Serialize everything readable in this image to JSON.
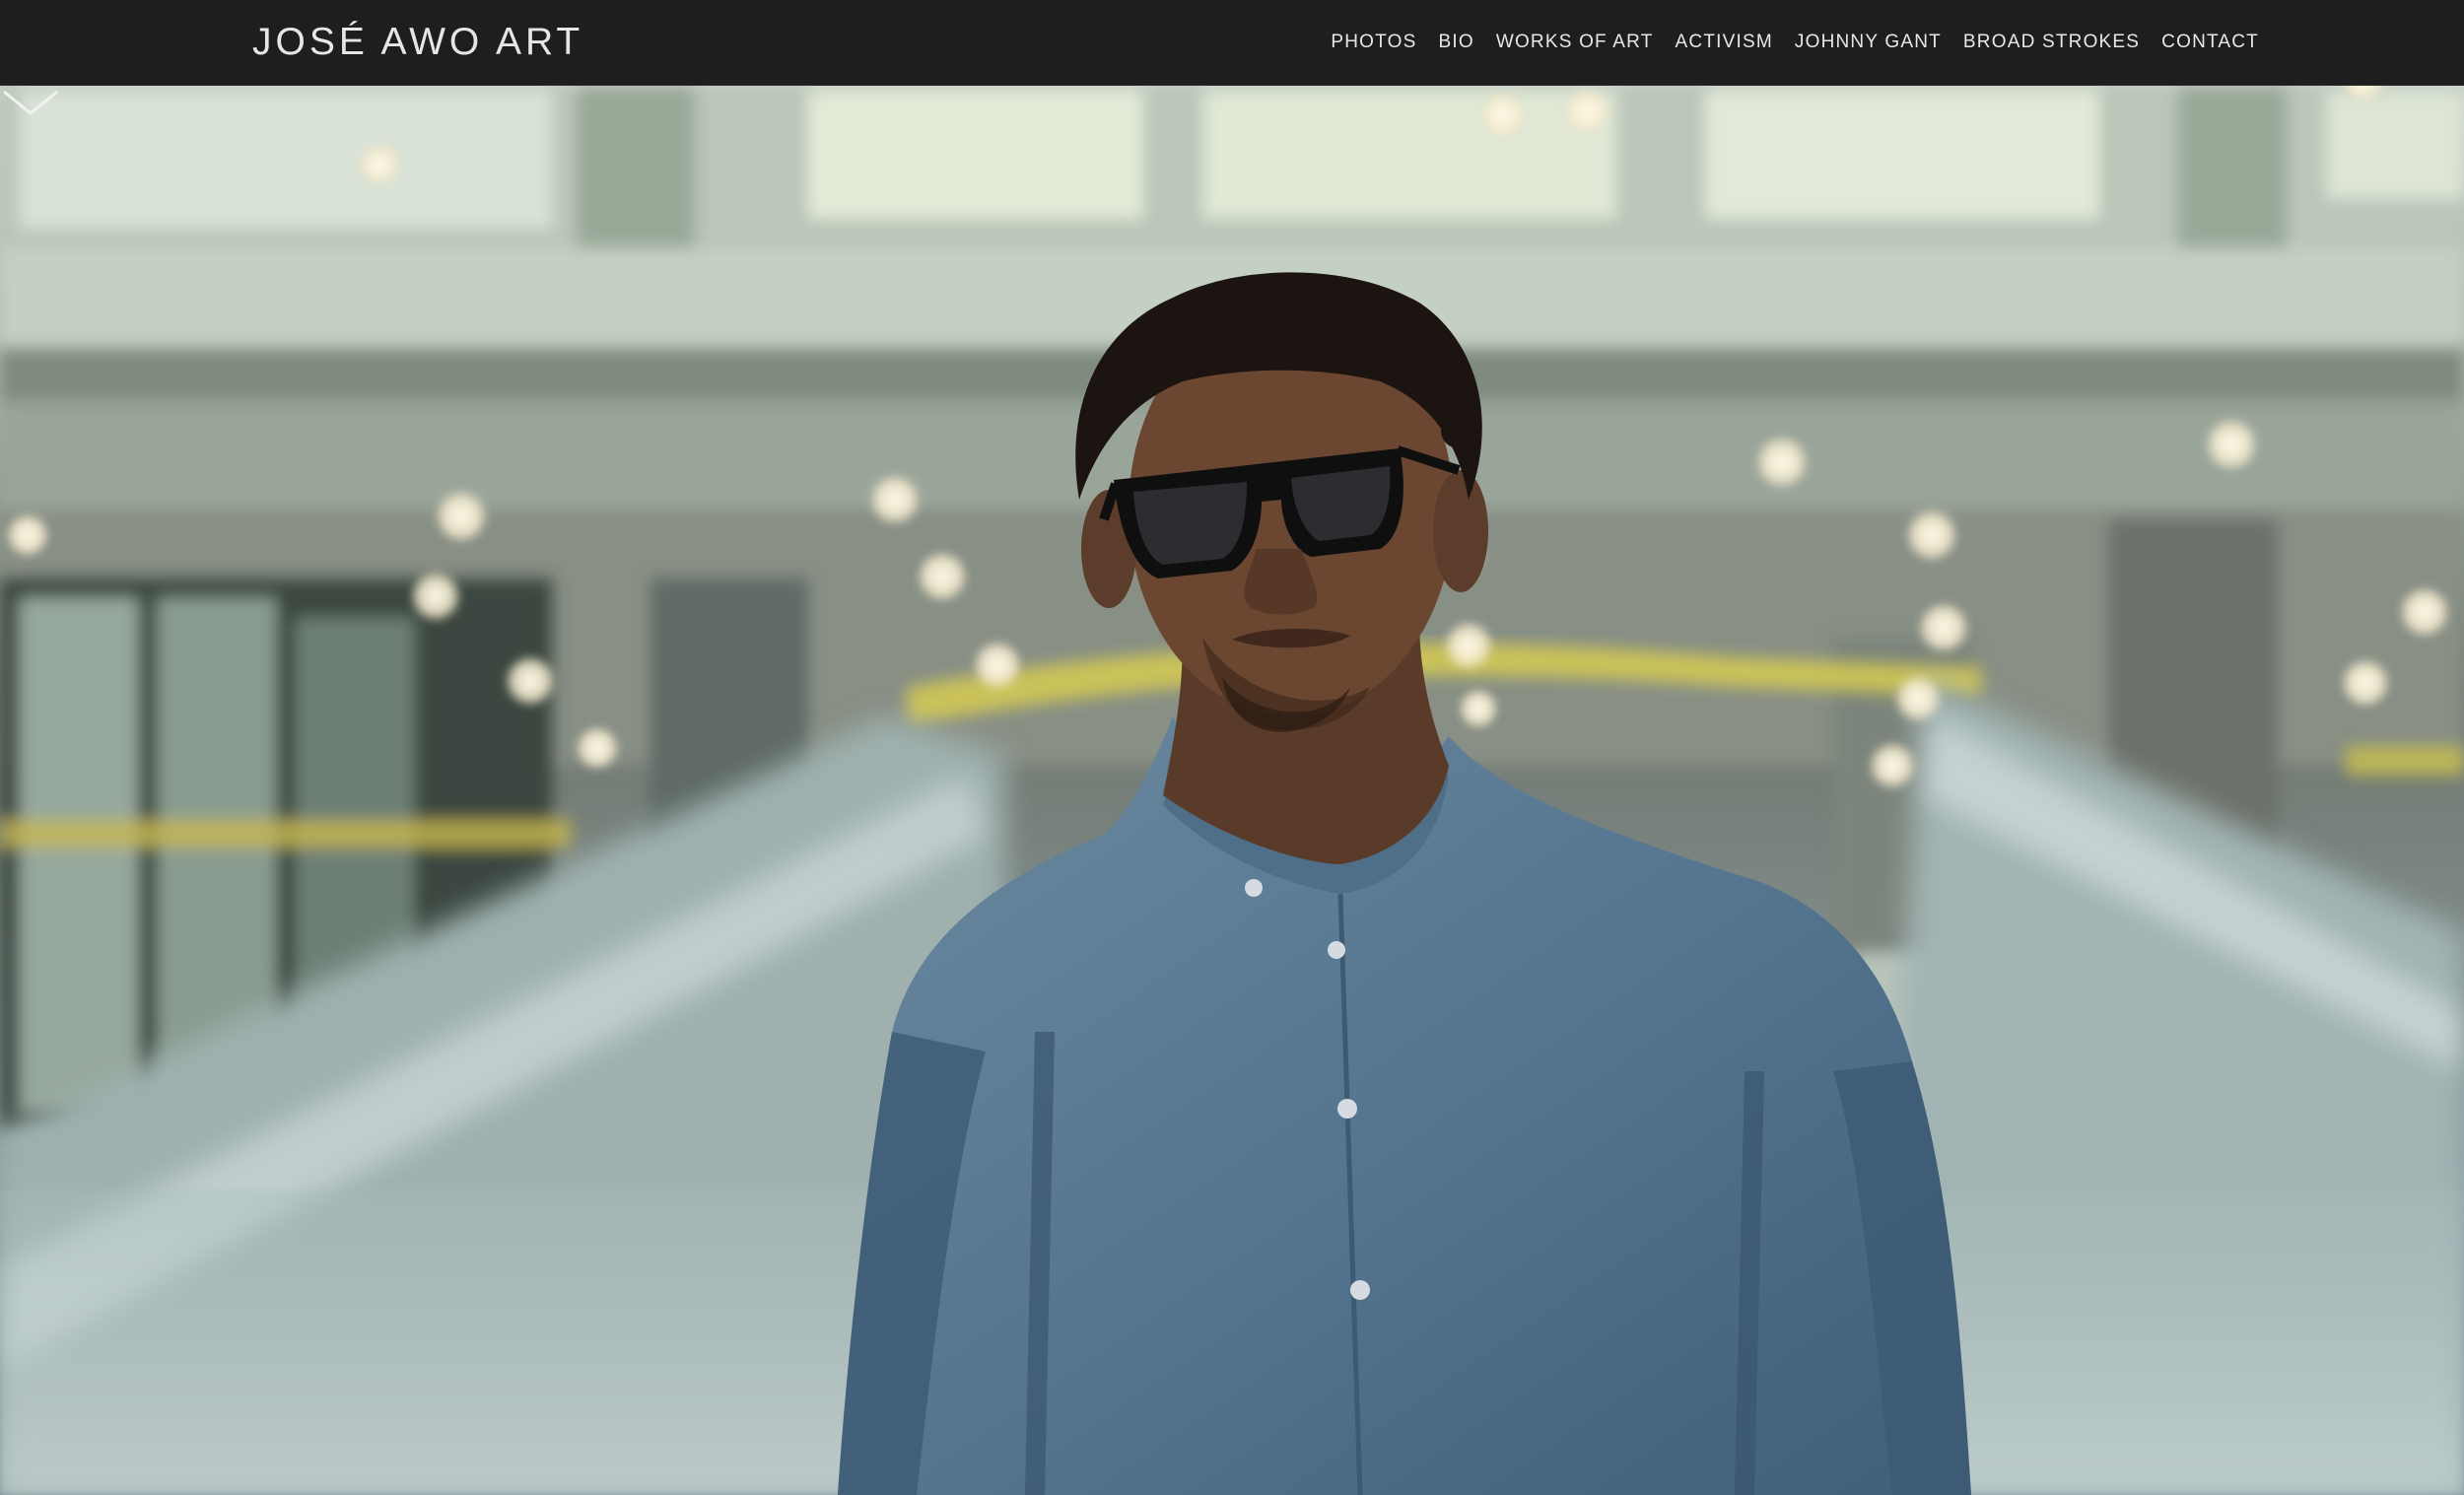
{
  "site": {
    "logo": "JOSÉ AWO ART"
  },
  "nav": {
    "items": [
      {
        "label": "PHOTOS"
      },
      {
        "label": "BIO"
      },
      {
        "label": "WORKS OF ART"
      },
      {
        "label": "ACTIVISM"
      },
      {
        "label": "JOHNNY GANT"
      },
      {
        "label": "BROAD STROKES"
      },
      {
        "label": "CONTACT"
      }
    ]
  },
  "hero": {
    "icon": "chevron-down-icon"
  },
  "colors": {
    "header_bg": "#1e1e1e",
    "header_text": "#e6e6e6"
  }
}
